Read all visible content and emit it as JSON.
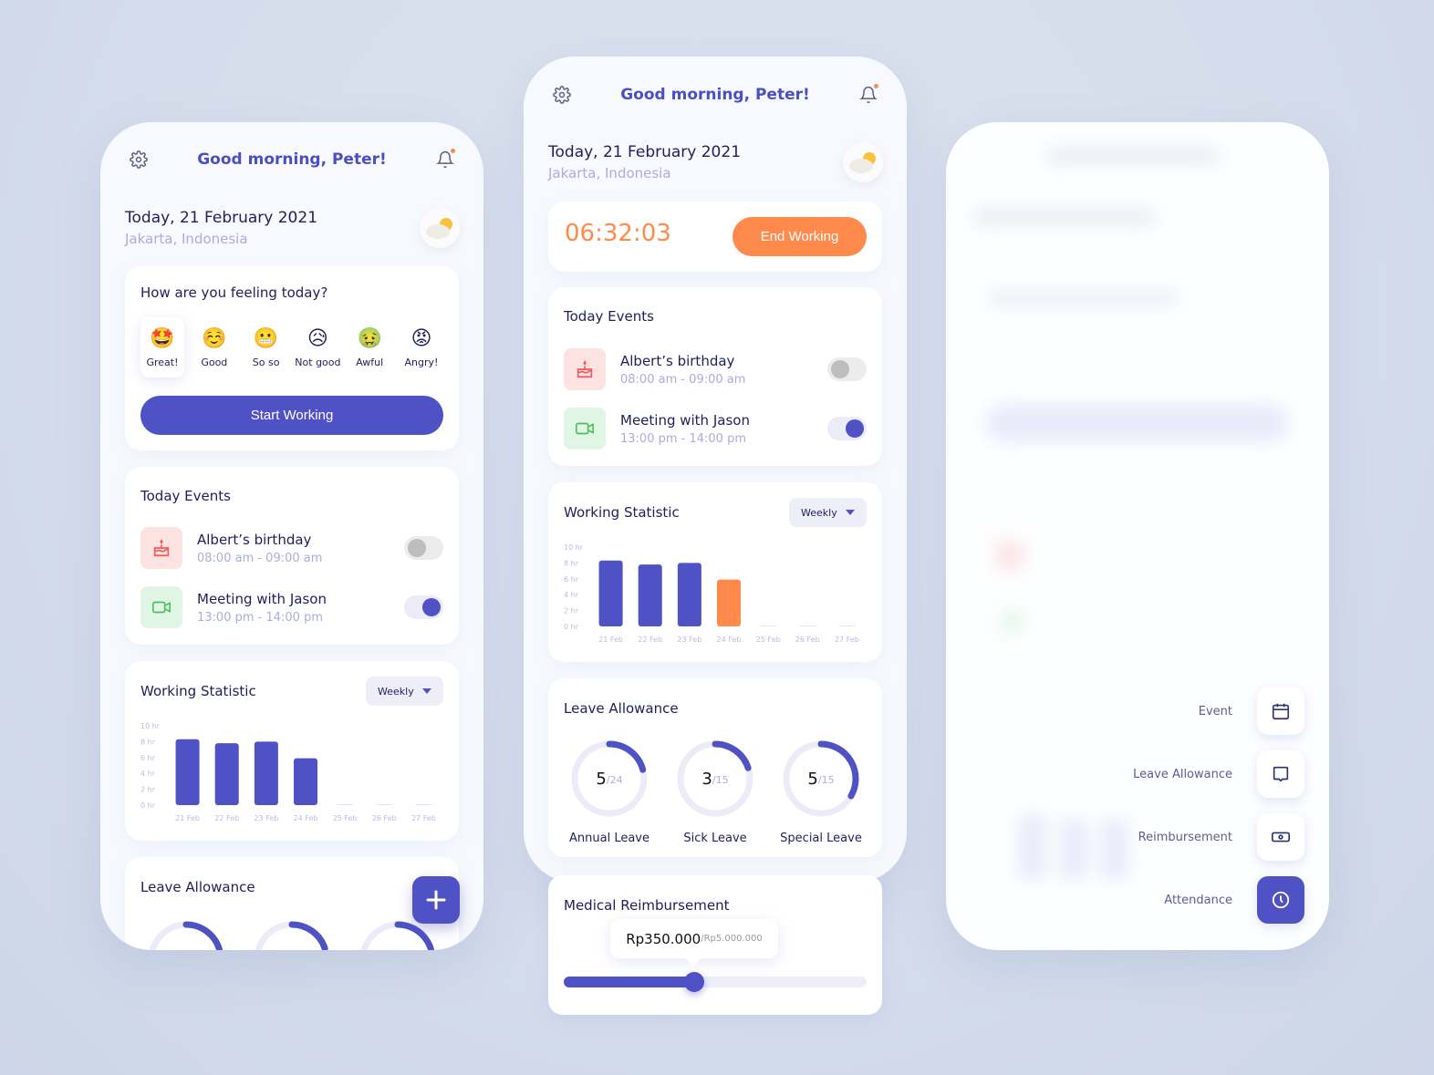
{
  "colors": {
    "primary": "#4f52c4",
    "accent_orange": "#ff8a4c",
    "text_dark": "#1f1f5e",
    "text_muted": "#a9acdf",
    "track": "#ececf9"
  },
  "header": {
    "greeting": "Good morning, Peter!",
    "settings_icon": "gear-icon",
    "notification_icon": "bell-icon",
    "has_notification": true
  },
  "today": {
    "date": "Today, 21 February 2021",
    "location": "Jakarta, Indonesia",
    "weather_icon": "partly-cloudy-icon"
  },
  "mood": {
    "question": "How are you feeling today?",
    "selected": "Great!",
    "options": [
      {
        "emoji": "🤩",
        "label": "Great!"
      },
      {
        "emoji": "☺️",
        "label": "Good"
      },
      {
        "emoji": "😬",
        "label": "So so"
      },
      {
        "emoji": "😥",
        "label": "Not good"
      },
      {
        "emoji": "🤢",
        "label": "Awful"
      },
      {
        "emoji": "😡",
        "label": "Angry!"
      }
    ],
    "start_button": "Start Working"
  },
  "timer": {
    "elapsed": "06:32:03",
    "end_button": "End Working"
  },
  "events": {
    "title": "Today Events",
    "items": [
      {
        "name": "Albert’s birthday",
        "time": "08:00 am - 09:00 am",
        "icon": "cake-icon",
        "enabled": false
      },
      {
        "name": "Meeting with Jason",
        "time": "13:00 pm - 14:00 pm",
        "icon": "video-camera-icon",
        "enabled": true
      }
    ]
  },
  "working_statistic": {
    "title": "Working Statistic",
    "period": "Weekly"
  },
  "chart_data": {
    "type": "bar",
    "title": "Working Statistic",
    "xlabel": "",
    "ylabel": "",
    "categories": [
      "21 Feb",
      "22 Feb",
      "23 Feb",
      "24 Feb",
      "25 Feb",
      "26 Feb",
      "27 Feb"
    ],
    "values": [
      8.3,
      7.8,
      8.0,
      5.9,
      0,
      0,
      0
    ],
    "unit": "hr",
    "yticks": [
      "0 hr",
      "2 hr",
      "4 hr",
      "6 hr",
      "8 hr",
      "10 hr"
    ],
    "ylim": [
      0,
      10
    ],
    "highlight_index_middle_screen": 3,
    "grid": false
  },
  "leave_allowance": {
    "title": "Leave Allowance",
    "items": [
      {
        "label": "Annual Leave",
        "used": 5,
        "total": 24,
        "used_text": "5",
        "total_text": "/24"
      },
      {
        "label": "Sick Leave",
        "used": 3,
        "total": 15,
        "used_text": "3",
        "total_text": "/15"
      },
      {
        "label": "Special Leave",
        "used": 5,
        "total": 15,
        "used_text": "5",
        "total_text": "/15"
      }
    ]
  },
  "reimbursement": {
    "title": "Medical Reimbursement",
    "amount": "Rp350.000",
    "limit": "/Rp5.000.000",
    "fraction": 0.43
  },
  "quick_actions": [
    {
      "label": "Event",
      "icon": "calendar-icon",
      "active": false
    },
    {
      "label": "Leave Allowance",
      "icon": "chat-bubble-icon",
      "active": false
    },
    {
      "label": "Reimbursement",
      "icon": "money-icon",
      "active": false
    },
    {
      "label": "Attendance",
      "icon": "clock-icon",
      "active": true
    }
  ],
  "fab": {
    "icon": "plus-icon"
  }
}
